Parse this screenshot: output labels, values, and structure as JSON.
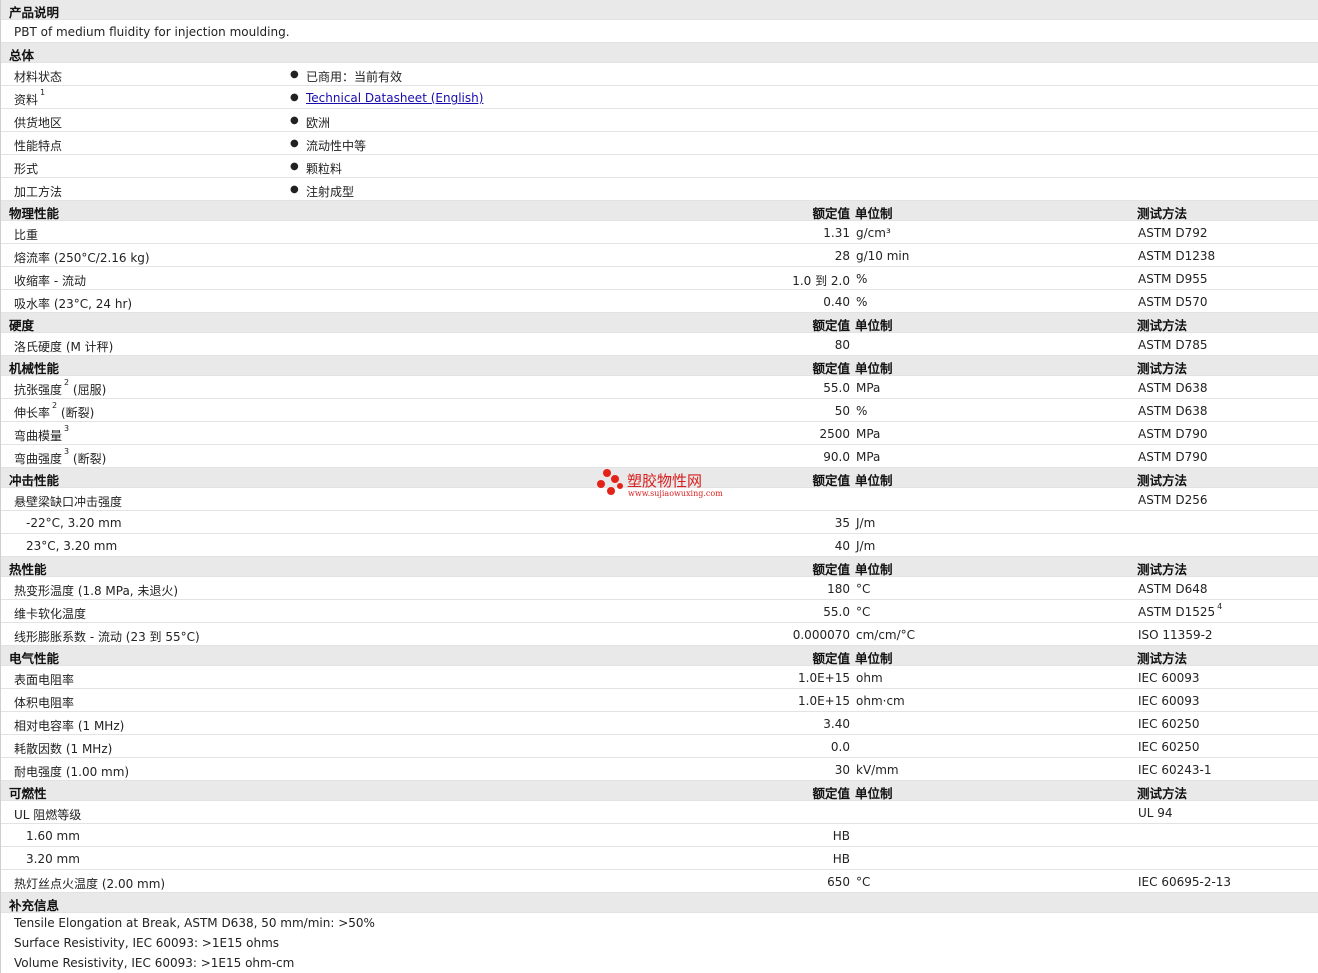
{
  "description": {
    "title": "产品说明",
    "text": "PBT of medium fluidity for injection moulding."
  },
  "general": {
    "title": "总体",
    "rows": [
      {
        "label": "材料状态",
        "value": "已商用：当前有效"
      },
      {
        "label": "资料",
        "sup": "1",
        "value": "Technical Datasheet (English)"
      },
      {
        "label": "供货地区",
        "value": "欧洲"
      },
      {
        "label": "性能特点",
        "value": "流动性中等"
      },
      {
        "label": "形式",
        "value": "颗粒料"
      },
      {
        "label": "加工方法",
        "value": "注射成型"
      }
    ]
  },
  "columns": {
    "value": "额定值",
    "unit": "单位制",
    "test": "测试方法"
  },
  "physical": {
    "title": "物理性能",
    "rows": [
      {
        "label": "比重",
        "value": "1.31",
        "unit": "g/cm³",
        "test": "ASTM D792"
      },
      {
        "label": "熔流率 (250°C/2.16 kg)",
        "value": "28",
        "unit": "g/10 min",
        "test": "ASTM D1238"
      },
      {
        "label": "收缩率 - 流动",
        "value": "1.0 到 2.0",
        "unit": "%",
        "test": "ASTM D955"
      },
      {
        "label": "吸水率 (23°C, 24 hr)",
        "value": "0.40",
        "unit": "%",
        "test": "ASTM D570"
      }
    ]
  },
  "hardness": {
    "title": "硬度",
    "rows": [
      {
        "label": "洛氏硬度 (M 计秤)",
        "value": "80",
        "unit": "",
        "test": "ASTM D785"
      }
    ]
  },
  "mechanical": {
    "title": "机械性能",
    "rows": [
      {
        "label": "抗张强度",
        "sup": "2",
        "suffix": " (屈服)",
        "value": "55.0",
        "unit": "MPa",
        "test": "ASTM D638"
      },
      {
        "label": "伸长率",
        "sup": "2",
        "suffix": " (断裂)",
        "value": "50",
        "unit": "%",
        "test": "ASTM D638"
      },
      {
        "label": "弯曲模量",
        "sup": "3",
        "suffix": "",
        "value": "2500",
        "unit": "MPa",
        "test": "ASTM D790"
      },
      {
        "label": "弯曲强度",
        "sup": "3",
        "suffix": " (断裂)",
        "value": "90.0",
        "unit": "MPa",
        "test": "ASTM D790"
      }
    ]
  },
  "impact": {
    "title": "冲击性能",
    "rows": [
      {
        "label": "悬壁梁缺口冲击强度",
        "value": "",
        "unit": "",
        "test": "ASTM D256"
      },
      {
        "label": "-22°C, 3.20 mm",
        "sub": true,
        "value": "35",
        "unit": "J/m",
        "test": ""
      },
      {
        "label": "23°C, 3.20 mm",
        "sub": true,
        "value": "40",
        "unit": "J/m",
        "test": ""
      }
    ]
  },
  "thermal": {
    "title": "热性能",
    "rows": [
      {
        "label": "热变形温度 (1.8 MPa, 未退火)",
        "value": "180",
        "unit": "°C",
        "test": "ASTM D648"
      },
      {
        "label": "维卡软化温度",
        "value": "55.0",
        "unit": "°C",
        "test": "ASTM D1525",
        "test_sup": "4"
      },
      {
        "label": "线形膨胀系数 - 流动 (23 到 55°C)",
        "value": "0.000070",
        "unit": "cm/cm/°C",
        "test": "ISO 11359-2"
      }
    ]
  },
  "electrical": {
    "title": "电气性能",
    "rows": [
      {
        "label": "表面电阻率",
        "value": "1.0E+15",
        "unit": "ohm",
        "test": "IEC 60093"
      },
      {
        "label": "体积电阻率",
        "value": "1.0E+15",
        "unit": "ohm·cm",
        "test": "IEC 60093"
      },
      {
        "label": "相对电容率 (1 MHz)",
        "value": "3.40",
        "unit": "",
        "test": "IEC 60250"
      },
      {
        "label": "耗散因数 (1 MHz)",
        "value": "0.0",
        "unit": "",
        "test": "IEC 60250"
      },
      {
        "label": "耐电强度 (1.00 mm)",
        "value": "30",
        "unit": "kV/mm",
        "test": "IEC 60243-1"
      }
    ]
  },
  "flammability": {
    "title": "可燃性",
    "rows": [
      {
        "label": "UL 阻燃等级",
        "value": "",
        "unit": "",
        "test": "UL 94"
      },
      {
        "label": "1.60 mm",
        "sub": true,
        "value": "HB",
        "unit": "",
        "test": ""
      },
      {
        "label": "3.20 mm",
        "sub": true,
        "value": "HB",
        "unit": "",
        "test": ""
      },
      {
        "label": "热灯丝点火温度 (2.00 mm)",
        "value": "650",
        "unit": "°C",
        "test": "IEC 60695-2-13"
      }
    ]
  },
  "supplemental": {
    "title": "补充信息",
    "lines": [
      "Tensile Elongation at Break, ASTM D638, 50 mm/min: >50%",
      "Surface Resistivity, IEC 60093: >1E15 ohms",
      "Volume Resistivity, IEC 60093: >1E15 ohm-cm"
    ]
  },
  "watermark": {
    "name": "塑胶物性网",
    "url": "www.sujiaowuxing.com"
  }
}
